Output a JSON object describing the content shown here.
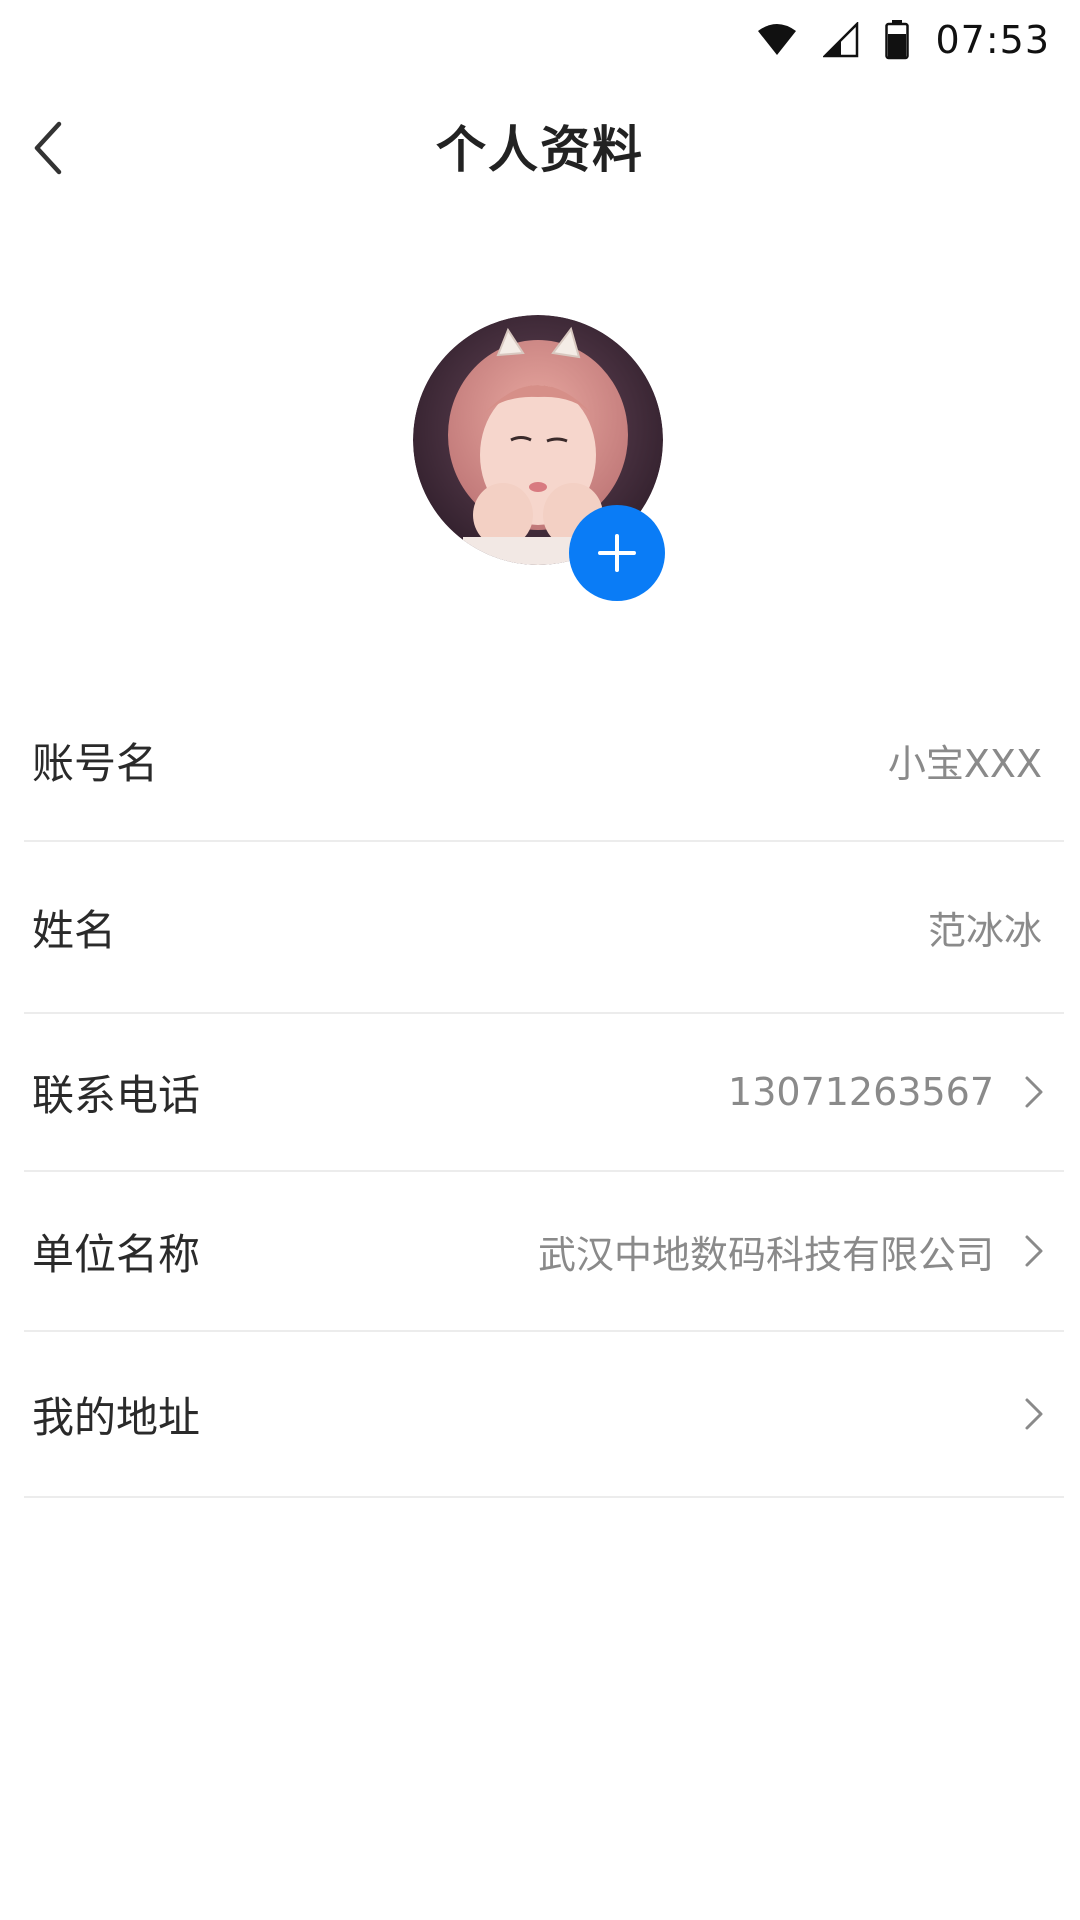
{
  "status_bar": {
    "time": "07:53",
    "icons": [
      "wifi-icon",
      "cellular-signal-icon",
      "battery-icon"
    ]
  },
  "header": {
    "title": "个人资料",
    "back_icon": "chevron-left-icon"
  },
  "avatar": {
    "add_icon": "plus-icon",
    "add_button_color": "#0a7cf6"
  },
  "profile": {
    "rows": [
      {
        "label": "账号名",
        "value": "小宝XXX",
        "has_chevron": false
      },
      {
        "label": "姓名",
        "value": "范冰冰",
        "has_chevron": false
      },
      {
        "label": "联系电话",
        "value": "13071263567",
        "has_chevron": true
      },
      {
        "label": "单位名称",
        "value": "武汉中地数码科技有限公司",
        "has_chevron": true
      },
      {
        "label": "我的地址",
        "value": "",
        "has_chevron": true
      }
    ]
  },
  "colors": {
    "label_text": "#2a2a2a",
    "value_text": "#8a8a8a",
    "divider": "#ececec",
    "accent": "#0a7cf6"
  }
}
